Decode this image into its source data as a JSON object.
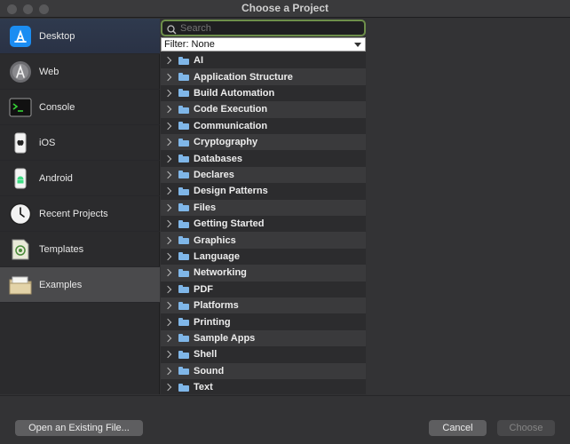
{
  "window": {
    "title": "Choose a Project"
  },
  "sidebar": {
    "items": [
      {
        "label": "Desktop",
        "icon": "app-store-icon"
      },
      {
        "label": "Web",
        "icon": "compass-icon"
      },
      {
        "label": "Console",
        "icon": "terminal-icon"
      },
      {
        "label": "iOS",
        "icon": "iphone-icon"
      },
      {
        "label": "Android",
        "icon": "android-icon"
      },
      {
        "label": "Recent Projects",
        "icon": "clock-icon"
      },
      {
        "label": "Templates",
        "icon": "template-document-icon"
      },
      {
        "label": "Examples",
        "icon": "folder-icon"
      }
    ]
  },
  "search": {
    "placeholder": "Search",
    "value": ""
  },
  "filter": {
    "label": "Filter: None"
  },
  "tree": {
    "items": [
      "AI",
      "Application Structure",
      "Build Automation",
      "Code Execution",
      "Communication",
      "Cryptography",
      "Databases",
      "Declares",
      "Design Patterns",
      "Files",
      "Getting Started",
      "Graphics",
      "Language",
      "Networking",
      "PDF",
      "Platforms",
      "Printing",
      "Sample Apps",
      "Shell",
      "Sound",
      "Text"
    ]
  },
  "buttons": {
    "open": "Open an Existing File...",
    "cancel": "Cancel",
    "choose": "Choose"
  },
  "colors": {
    "search_focus": "#6d8e4a",
    "folder": "#7fb6e8",
    "selected": "#4a4a4c"
  }
}
